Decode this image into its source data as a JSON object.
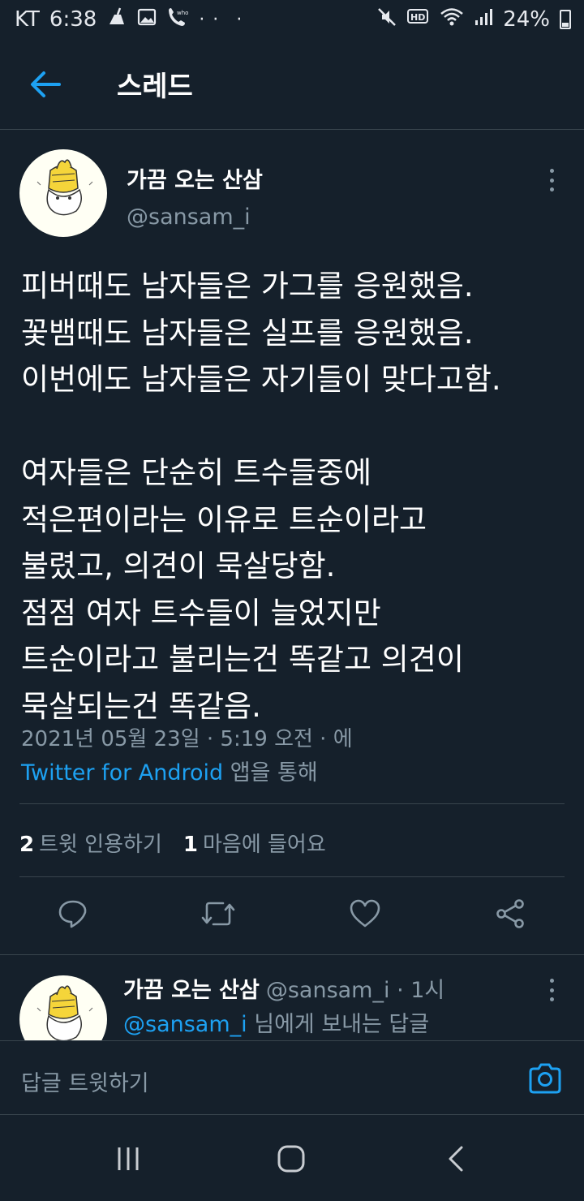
{
  "status_bar": {
    "carrier": "KT",
    "time": "6:38",
    "battery": "24%"
  },
  "app_bar": {
    "title": "스레드"
  },
  "tweet": {
    "author_name": "가끔 오는 산삼",
    "author_handle": "@sansam_i",
    "body": "피버때도 남자들은 가그를 응원했음.\n꽃뱀때도 남자들은 실프를 응원했음.\n이번에도 남자들은 자기들이 맞다고함.\n\n여자들은 단순히 트수들중에\n적은편이라는 이유로 트순이라고\n불렸고, 의견이 묵살당함.\n점점 여자 트수들이 늘었지만\n트순이라고 불리는건 똑같고 의견이\n묵살되는건 똑같음.",
    "timestamp": "2021년 05월 23일 · 5:19 오전 · 에",
    "via_app": "Twitter for Android",
    "via_suffix": " 앱을 통해",
    "quote_count": "2",
    "quote_label": "트윗 인용하기",
    "like_count": "1",
    "like_label": "마음에 들어요"
  },
  "reply": {
    "author_name": "가끔 오는 산삼",
    "meta": "@sansam_i · 1시",
    "reply_to_handle": "@sansam_i",
    "reply_to_suffix": " 님에게 보내는 답글"
  },
  "compose": {
    "placeholder": "답글 트윗하기"
  },
  "colors": {
    "background": "#15202b",
    "accent": "#1da1f2",
    "secondary_text": "#8899a6",
    "divider": "#38444d"
  }
}
